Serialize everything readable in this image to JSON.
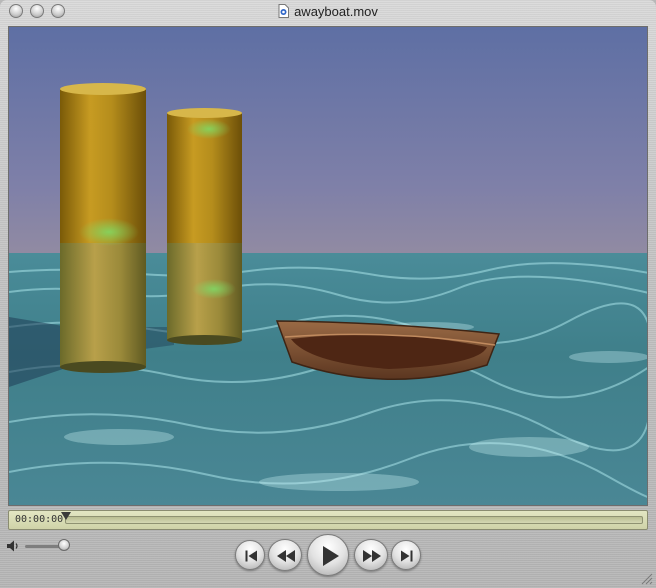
{
  "window": {
    "title": "awayboat.mov"
  },
  "player": {
    "timecode": "00:00:00",
    "progress_fraction": 0.0,
    "volume_fraction": 0.85
  },
  "icons": {
    "document": "quicktime-document-icon",
    "volume": "speaker-icon",
    "buttons": [
      "skip-to-start-icon",
      "rewind-icon",
      "play-icon",
      "fast-forward-icon",
      "skip-to-end-icon"
    ]
  },
  "colors": {
    "sky_top": "#5f70a3",
    "sky_bottom": "#8e8aa4",
    "water": "#3f7d86",
    "pillar": "#b08a1d",
    "boat": "#7a4a2a",
    "timebar": "#d8dbb2"
  }
}
